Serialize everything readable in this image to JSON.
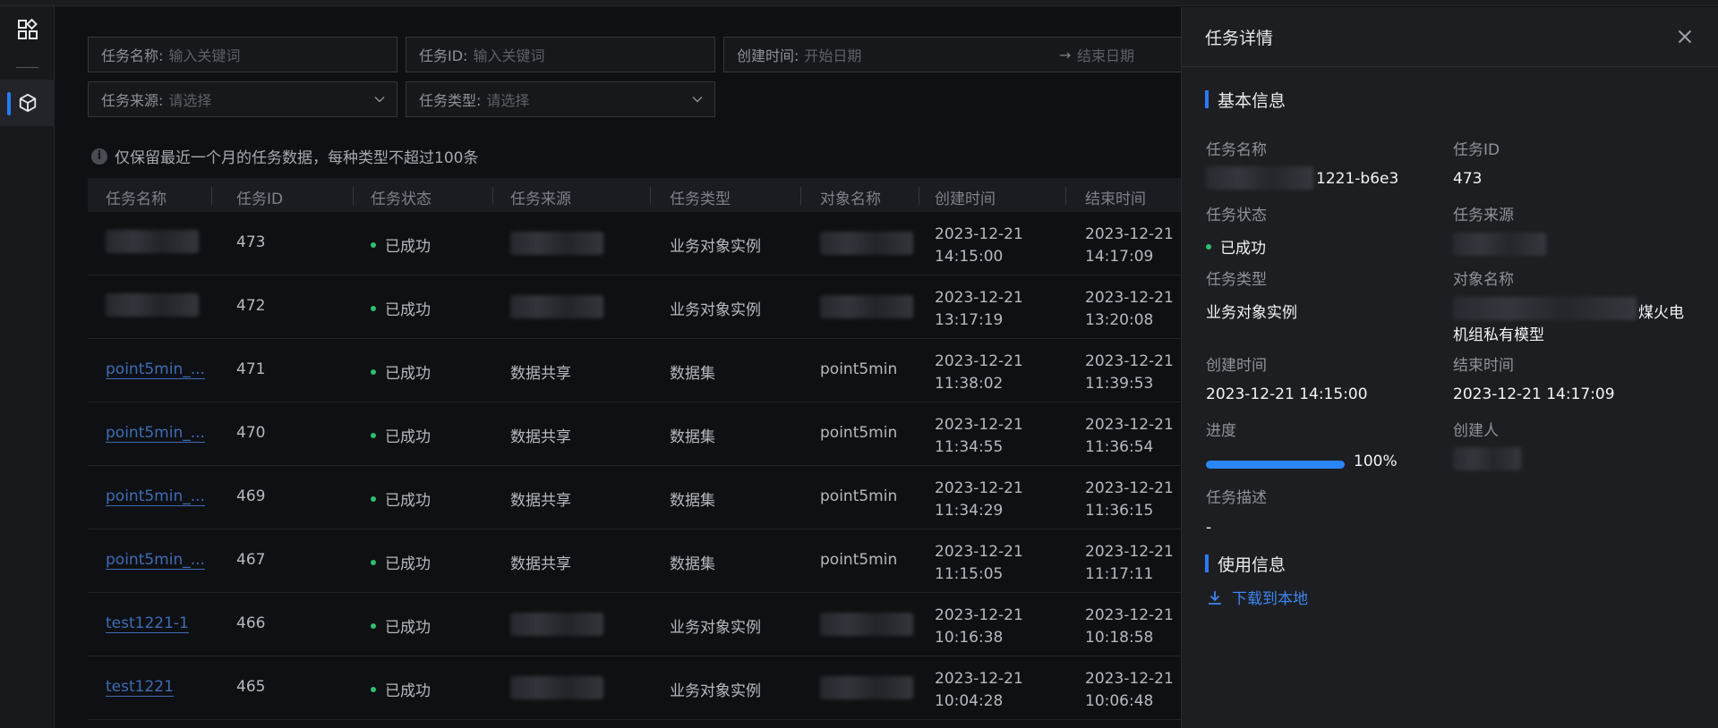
{
  "filters": {
    "task_name_label": "任务名称:",
    "task_name_placeholder": "输入关键词",
    "task_id_label": "任务ID:",
    "task_id_placeholder": "输入关键词",
    "create_time_label": "创建时间:",
    "start_placeholder": "开始日期",
    "range_arrow": "→",
    "end_placeholder": "结束日期",
    "source_label": "任务来源:",
    "source_placeholder": "请选择",
    "type_label": "任务类型:",
    "type_placeholder": "请选择"
  },
  "notice": "仅保留最近一个月的任务数据，每种类型不超过100条",
  "columns": [
    "任务名称",
    "任务ID",
    "任务状态",
    "任务来源",
    "任务类型",
    "对象名称",
    "创建时间",
    "结束时间"
  ],
  "rows": [
    {
      "name": "",
      "id": "473",
      "status": "已成功",
      "source": "",
      "type": "业务对象实例",
      "object": "",
      "created_date": "2023-12-21",
      "created_time": "14:15:00",
      "end_date": "2023-12-21",
      "end_time": "14:17:09"
    },
    {
      "name": "",
      "id": "472",
      "status": "已成功",
      "source": "",
      "type": "业务对象实例",
      "object": "",
      "created_date": "2023-12-21",
      "created_time": "13:17:19",
      "end_date": "2023-12-21",
      "end_time": "13:20:08"
    },
    {
      "name": "point5min_...",
      "id": "471",
      "status": "已成功",
      "source": "数据共享",
      "type": "数据集",
      "object": "point5min",
      "created_date": "2023-12-21",
      "created_time": "11:38:02",
      "end_date": "2023-12-21",
      "end_time": "11:39:53"
    },
    {
      "name": "point5min_...",
      "id": "470",
      "status": "已成功",
      "source": "数据共享",
      "type": "数据集",
      "object": "point5min",
      "created_date": "2023-12-21",
      "created_time": "11:34:55",
      "end_date": "2023-12-21",
      "end_time": "11:36:54"
    },
    {
      "name": "point5min_...",
      "id": "469",
      "status": "已成功",
      "source": "数据共享",
      "type": "数据集",
      "object": "point5min",
      "created_date": "2023-12-21",
      "created_time": "11:34:29",
      "end_date": "2023-12-21",
      "end_time": "11:36:15"
    },
    {
      "name": "point5min_...",
      "id": "467",
      "status": "已成功",
      "source": "数据共享",
      "type": "数据集",
      "object": "point5min",
      "created_date": "2023-12-21",
      "created_time": "11:15:05",
      "end_date": "2023-12-21",
      "end_time": "11:17:11"
    },
    {
      "name": "test1221-1",
      "id": "466",
      "status": "已成功",
      "source": "",
      "type": "业务对象实例",
      "object": "",
      "created_date": "2023-12-21",
      "created_time": "10:16:38",
      "end_date": "2023-12-21",
      "end_time": "10:18:58"
    },
    {
      "name": "test1221",
      "id": "465",
      "status": "已成功",
      "source": "",
      "type": "业务对象实例",
      "object": "",
      "created_date": "2023-12-21",
      "created_time": "10:04:28",
      "end_date": "2023-12-21",
      "end_time": "10:06:48"
    }
  ],
  "detail": {
    "title": "任务详情",
    "basic_section": "基本信息",
    "k_name": "任务名称",
    "v_name": "1221-b6e3",
    "k_id": "任务ID",
    "v_id": "473",
    "k_status": "任务状态",
    "v_status": "已成功",
    "k_source": "任务来源",
    "k_type": "任务类型",
    "v_type": "业务对象实例",
    "k_object": "对象名称",
    "v_object_line1": "煤火电",
    "v_object_line2": "机组私有模型",
    "k_created": "创建时间",
    "v_created": "2023-12-21 14:15:00",
    "k_end": "结束时间",
    "v_end": "2023-12-21 14:17:09",
    "k_progress": "进度",
    "progress": 1.0,
    "progress_text": "100%",
    "k_creator": "创建人",
    "k_desc": "任务描述",
    "v_desc": "-",
    "usage_section": "使用信息",
    "download": "下载到本地"
  },
  "colors": {
    "accent": "#2b7bf5",
    "success": "#2fbf71",
    "link": "#3f6cb5"
  },
  "icons": [
    "apps-grid-icon",
    "cube-icon",
    "info-icon",
    "chevron-down-icon",
    "close-icon",
    "download-icon"
  ]
}
